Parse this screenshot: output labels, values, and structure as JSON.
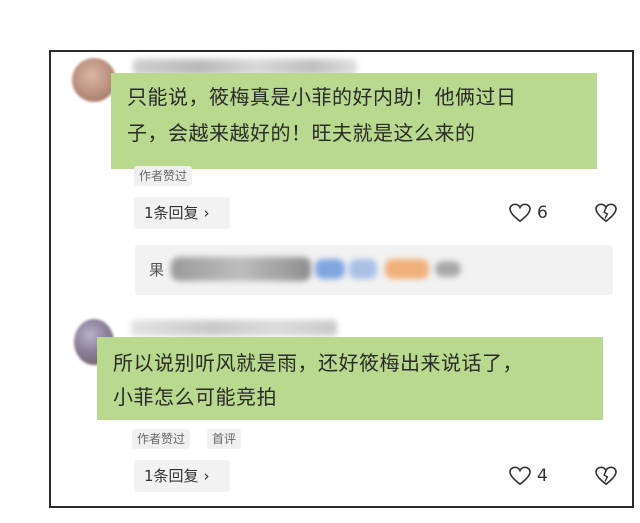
{
  "comments": [
    {
      "author_obscured": true,
      "text_lines": [
        "只能说，筱梅真是小菲的好内助！他俩过日",
        "子，会越来越好的！旺夫就是这么来的"
      ],
      "tags": [
        "作者赞过"
      ],
      "reply_button": "1条回复",
      "like_count": "6"
    },
    {
      "author_obscured": true,
      "text_lines": [
        "所以说别听风就是雨，还好筱梅出来说话了，",
        "小菲怎么可能竞拍"
      ],
      "tags": [
        "作者赞过",
        "首评"
      ],
      "reply_button": "1条回复",
      "like_count": "4"
    }
  ],
  "subreply_preview": {
    "visible_prefix": "果"
  },
  "icons": {
    "reply_chevron": "chevron-right-icon",
    "like": "heart-outline-icon",
    "dislike": "broken-heart-icon"
  },
  "colors": {
    "bubble_highlight": "#b9d98f",
    "frame_border": "#2b2b2b",
    "tag_bg": "#f0f0f0",
    "button_bg": "#f2f2f2"
  }
}
